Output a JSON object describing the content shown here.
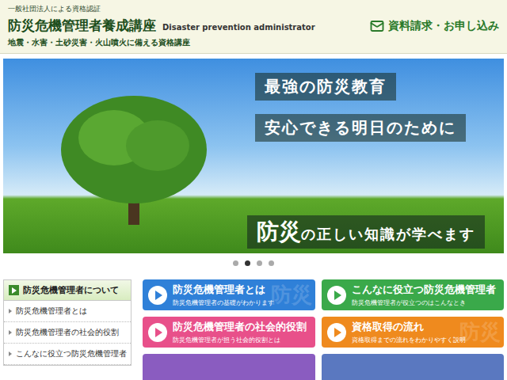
{
  "header": {
    "tagline": "一般社団法人による資格認証",
    "title": "防災危機管理者養成講座",
    "subtitle_en": "Disaster prevention administrator",
    "catch": "地震・水害・土砂災害・火山噴火に備える資格講座",
    "contact": {
      "label": "資料請求・お申し込み"
    }
  },
  "hero": {
    "captions": [
      "最強の防災教育",
      "安心できる明日のために"
    ],
    "banner": {
      "emphasis": "防災",
      "text": "の正しい知識が学べます"
    }
  },
  "slider_dots": [
    {
      "selected": false
    },
    {
      "selected": true
    },
    {
      "selected": false
    },
    {
      "selected": false
    }
  ],
  "sidebar": {
    "title": "防災危機管理者について",
    "items": [
      "防災危機管理者とは",
      "防災危機管理者の社会的役割",
      "こんなに役立つ防災危機管理者"
    ]
  },
  "cards": [
    {
      "kind": "full",
      "title": "防災危機管理者とは",
      "description": "防災危機管理者の基礎がわかります",
      "color": "#2f80d8",
      "watermark": "防災"
    },
    {
      "kind": "full",
      "title": "こんなに役立つ防災危機管理者",
      "description": "防災危機管理者が役立つのはこんなとき",
      "color": "#3aa94a"
    },
    {
      "kind": "full",
      "title": "防災危機管理者の社会的役割",
      "description": "防災危機管理者が担う社会的役割とは",
      "color": "#e8508a"
    },
    {
      "kind": "full",
      "title": "資格取得の流れ",
      "description": "資格取得までの流れをわかりやすく説明",
      "color": "#ef8a1e",
      "watermark": "防災"
    },
    {
      "kind": "cut",
      "color": "#8a5cc0"
    },
    {
      "kind": "cut",
      "color": "#5a78c0"
    }
  ]
}
